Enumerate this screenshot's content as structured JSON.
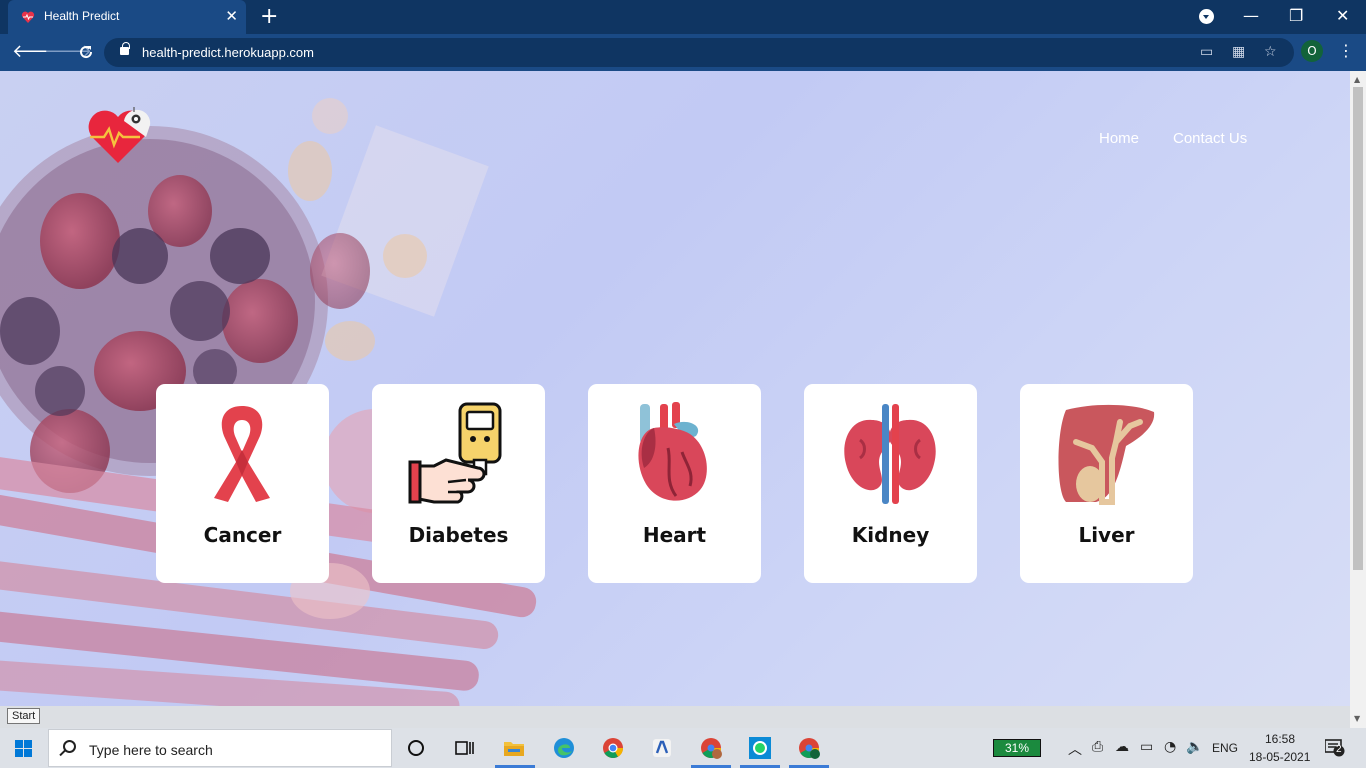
{
  "browser": {
    "tab_title": "Health Predict",
    "tab_close": "✕",
    "new_tab": "+",
    "url": "health-predict.herokuapp.com",
    "profile_initial": "O",
    "window_controls": {
      "minimize": "—",
      "restore": "❐",
      "close": "✕"
    }
  },
  "site": {
    "nav": {
      "home": "Home",
      "contact": "Contact Us"
    },
    "cards": [
      {
        "label": "Cancer",
        "icon": "cancer-ribbon-icon"
      },
      {
        "label": "Diabetes",
        "icon": "glucometer-icon"
      },
      {
        "label": "Heart",
        "icon": "heart-organ-icon"
      },
      {
        "label": "Kidney",
        "icon": "kidney-icon"
      },
      {
        "label": "Liver",
        "icon": "liver-icon"
      }
    ]
  },
  "os": {
    "start_tooltip": "Start",
    "search_placeholder": "Type here to search",
    "battery": "31%",
    "language": "ENG",
    "time": "16:58",
    "date": "18-05-2021",
    "notifications": "2"
  },
  "colors": {
    "tab_bar": "#0f3562",
    "toolbar": "#1a4a85",
    "page_bg": "#c6cef3",
    "card_bg": "#ffffff"
  }
}
